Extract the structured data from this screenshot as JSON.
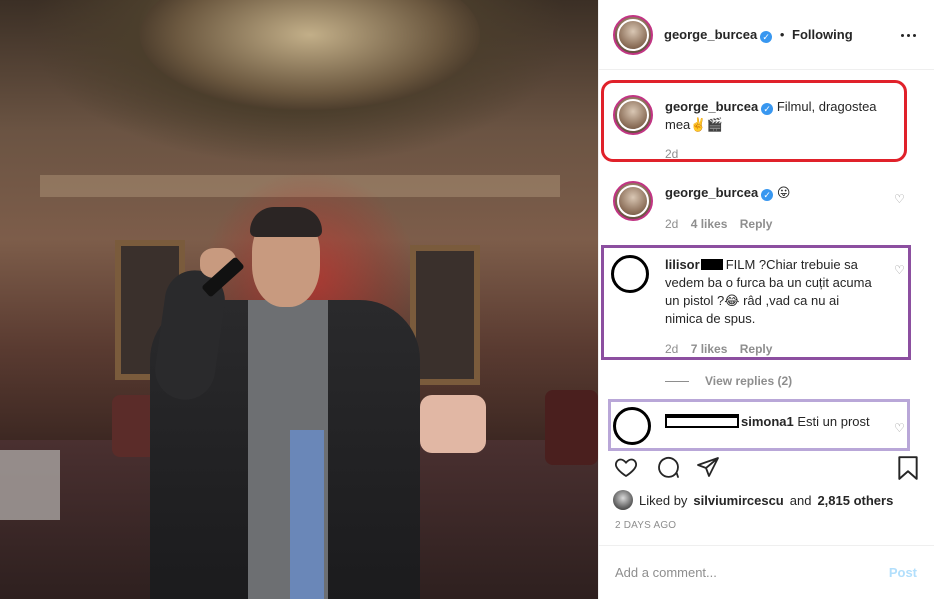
{
  "header": {
    "username": "george_burcea",
    "separator": "•",
    "follow_status": "Following"
  },
  "caption": {
    "username": "george_burcea",
    "text": "Filmul, dragostea mea✌️🎬",
    "age": "2d"
  },
  "comments": [
    {
      "username": "george_burcea",
      "text": "😛",
      "age": "2d",
      "likes": "4 likes",
      "reply_label": "Reply"
    },
    {
      "username": "lilisor",
      "text": "FILM ?Chiar trebuie sa vedem ba o furca ba un cuțit acuma un pistol ?😂 râd ,vad ca nu ai nimica de spus.",
      "age": "2d",
      "likes": "7 likes",
      "reply_label": "Reply",
      "view_replies": "View replies (2)"
    },
    {
      "username": "simona1",
      "text": "Esti un prost"
    }
  ],
  "likes": {
    "prefix": "Liked by",
    "user": "silviumircescu",
    "conj": "and",
    "others": "2,815 others"
  },
  "timestamp": "2 DAYS AGO",
  "add_comment": {
    "placeholder": "Add a comment...",
    "post_label": "Post"
  },
  "colors": {
    "red_box": "#e0212a",
    "purple_box": "#8c4fa0",
    "lavender_box": "#b9a7d8",
    "verified": "#3897f0",
    "post_disabled": "#b2dffc"
  },
  "icons": [
    "heart-icon",
    "comment-icon",
    "share-icon",
    "bookmark-icon",
    "more-icon",
    "verified-badge-icon"
  ]
}
